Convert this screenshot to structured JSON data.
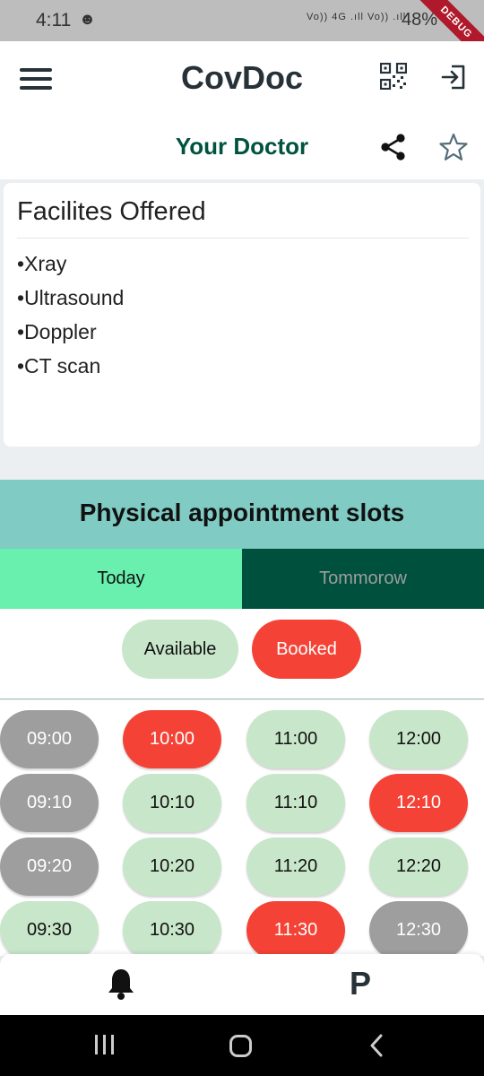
{
  "status_bar": {
    "time": "4:11",
    "network_text": "Vo)) 4G .ıll Vo)) .ıll",
    "battery": "48%",
    "debug_banner": "DEBUG"
  },
  "app_bar": {
    "title": "CovDoc",
    "icons": [
      "menu-icon",
      "qr-code-icon",
      "logout-icon"
    ]
  },
  "doctor_header": {
    "title": "Your Doctor",
    "icons": [
      "share-icon",
      "star-outline-icon"
    ]
  },
  "facilities": {
    "title": "Facilites Offered",
    "items": [
      "•Xray",
      "•Ultrasound",
      "•Doppler",
      "•CT scan"
    ]
  },
  "appointments": {
    "title": "Physical appointment slots",
    "tabs": [
      {
        "label": "Today",
        "selected": true
      },
      {
        "label": "Tommorow",
        "selected": false
      }
    ],
    "legend": {
      "available": "Available",
      "booked": "Booked"
    },
    "colors": {
      "available": "#c8e6c9",
      "booked": "#f44336",
      "unavailable": "#9e9e9e"
    },
    "slots": [
      [
        {
          "time": "09:00",
          "status": "unavailable"
        },
        {
          "time": "09:10",
          "status": "unavailable"
        },
        {
          "time": "09:20",
          "status": "unavailable"
        },
        {
          "time": "09:30",
          "status": "available"
        }
      ],
      [
        {
          "time": "10:00",
          "status": "booked"
        },
        {
          "time": "10:10",
          "status": "available"
        },
        {
          "time": "10:20",
          "status": "available"
        },
        {
          "time": "10:30",
          "status": "available"
        }
      ],
      [
        {
          "time": "11:00",
          "status": "available"
        },
        {
          "time": "11:10",
          "status": "available"
        },
        {
          "time": "11:20",
          "status": "available"
        },
        {
          "time": "11:30",
          "status": "booked"
        }
      ],
      [
        {
          "time": "12:00",
          "status": "available"
        },
        {
          "time": "12:10",
          "status": "booked"
        },
        {
          "time": "12:20",
          "status": "available"
        },
        {
          "time": "12:30",
          "status": "unavailable"
        }
      ]
    ]
  },
  "bottom_nav": {
    "items": [
      {
        "icon": "bell-icon"
      },
      {
        "label": "P"
      }
    ]
  },
  "system_nav": {
    "icons": [
      "recent-apps-icon",
      "home-icon",
      "back-icon"
    ]
  }
}
